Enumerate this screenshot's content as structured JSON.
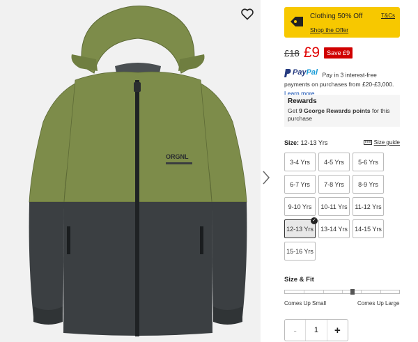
{
  "promo": {
    "title": "Clothing 50% Off",
    "tcs": "T&Cs",
    "shop_link": "Shop the Offer",
    "color": "#f7c800"
  },
  "price": {
    "was": "£18",
    "now": "£9",
    "save": "Save £9"
  },
  "paypal": {
    "brand_a": "Pay",
    "brand_b": "Pal",
    "text": "Pay in 3 interest-free payments on purchases from £20-£3,000.",
    "link": "Learn more"
  },
  "rewards": {
    "title": "Rewards",
    "prefix": "Get",
    "points": "9 George Rewards points",
    "suffix": "for this purchase"
  },
  "size": {
    "label": "Size:",
    "selected": "12-13 Yrs",
    "guide": "Size guide",
    "options": [
      "3-4 Yrs",
      "4-5 Yrs",
      "5-6 Yrs",
      "6-7 Yrs",
      "7-8 Yrs",
      "8-9 Yrs",
      "9-10 Yrs",
      "10-11 Yrs",
      "11-12 Yrs",
      "12-13 Yrs",
      "13-14 Yrs",
      "14-15 Yrs",
      "15-16 Yrs"
    ]
  },
  "fit": {
    "title": "Size & Fit",
    "low": "Comes Up Small",
    "high": "Comes Up Large",
    "level": 0.5
  },
  "quantity": {
    "minus": "-",
    "value": "1",
    "plus": "+"
  },
  "product_image": {
    "chest_print": "ORGNL",
    "upper_color": "#7d8c4a",
    "lower_color": "#3b3f42"
  }
}
